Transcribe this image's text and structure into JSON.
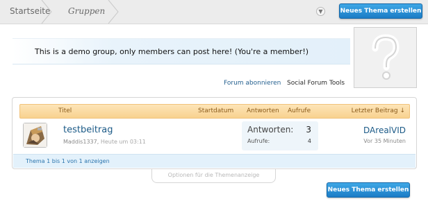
{
  "breadcrumb": {
    "home": "Startseite",
    "current": "Gruppen"
  },
  "buttons": {
    "new_thread_top": "Neues Thema erstellen",
    "new_thread_bottom": "Neues Thema erstellen"
  },
  "notice": {
    "text": "This is a demo group, only members can post here! (You're a member!)"
  },
  "links": {
    "subscribe": "Forum abonnieren",
    "tools": "Social Forum Tools"
  },
  "table": {
    "headers": {
      "title": "Titel",
      "start_date": "Startdatum",
      "replies": "Antworten",
      "views": "Aufrufe",
      "last_post": "Letzter Beitrag ↓"
    },
    "threads": [
      {
        "title": "testbeitrag",
        "author": "Maddis1337",
        "separator": ",",
        "started": "Heute um 03:11",
        "replies_label": "Antworten:",
        "replies": "3",
        "views_label": "Aufrufe:",
        "views": "4",
        "last_user": "DArealVID",
        "last_time": "Vor 35 Minuten"
      }
    ],
    "footer": "Thema 1 bis 1 von 1 anzeigen"
  },
  "options_tab": "Optionen für die Themenanzeige",
  "icons": {
    "jump": "chevron-down-icon",
    "group_logo": "question-mark-placeholder-icon",
    "avatar": "user-avatar-icon"
  },
  "colors": {
    "accent": "#1b7cc6",
    "link": "#1b5a87",
    "header_bg": "#f8d28f",
    "notice_bg": "#e3f0fa"
  }
}
